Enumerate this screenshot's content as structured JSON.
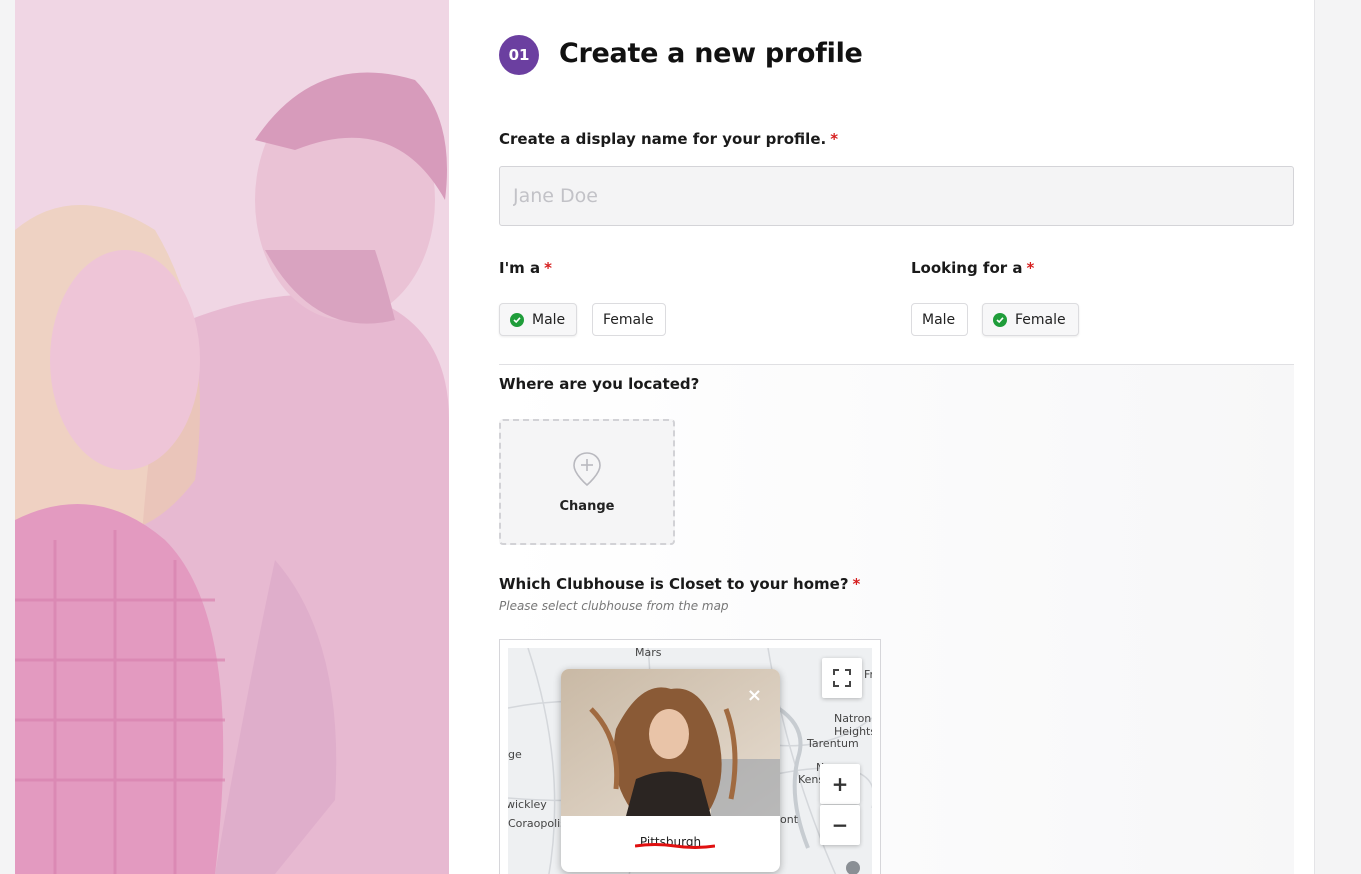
{
  "step": {
    "number": "01",
    "title": "Create a new profile"
  },
  "display_name": {
    "label": "Create a display name for your profile.",
    "required_mark": "*",
    "placeholder": "Jane Doe"
  },
  "im_a": {
    "label": "I'm a",
    "required_mark": "*",
    "options": [
      {
        "label": "Male",
        "selected": true
      },
      {
        "label": "Female",
        "selected": false
      }
    ]
  },
  "looking_for": {
    "label": "Looking for a",
    "required_mark": "*",
    "options": [
      {
        "label": "Male",
        "selected": false
      },
      {
        "label": "Female",
        "selected": true
      }
    ]
  },
  "location": {
    "label": "Where are you located?",
    "button_label": "Change",
    "icon": "map-pin-plus-icon"
  },
  "clubhouse": {
    "label": "Which Clubhouse is Closet to your home?",
    "required_mark": "*",
    "hint": "Please select clubhouse from the map"
  },
  "map": {
    "places": [
      "Mars",
      "Natrona Heights",
      "Tarentum",
      "Kens",
      "N",
      "wickley",
      "Coraopolis",
      "ge",
      "ont",
      "Fr"
    ],
    "zoom_in": "+",
    "zoom_out": "−",
    "popup_close": "×",
    "popup_name": "Pittsburgh"
  },
  "colors": {
    "accent": "#6b3fa0",
    "required": "#d61f1f",
    "check": "#1f9d3a",
    "photo_tint": "#f2d3e3"
  }
}
